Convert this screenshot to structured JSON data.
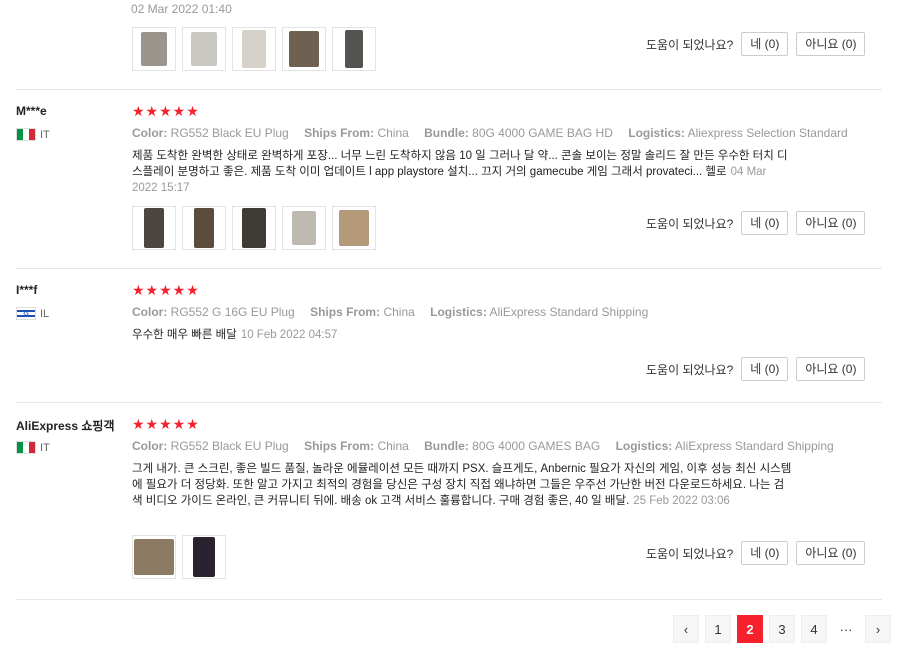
{
  "top_review": {
    "date": "02 Mar 2022 01:40",
    "photo_icons": [
      "photo-1",
      "photo-2",
      "photo-3",
      "photo-4",
      "photo-5"
    ],
    "helpful_q": "도움이 되었나요?",
    "yes_label": "네 (0)",
    "no_label": "아니요 (0)"
  },
  "reviews": [
    {
      "name": "M***e",
      "country": "IT",
      "stars": "★★★★★",
      "attrs": [
        {
          "k": "Color:",
          "v": "RG552 Black EU Plug"
        },
        {
          "k": "Ships From:",
          "v": "China"
        },
        {
          "k": "Bundle:",
          "v": "80G 4000 GAME BAG HD"
        },
        {
          "k": "Logistics:",
          "v": "Aliexpress Selection Standard"
        }
      ],
      "text": "제품 도착한 완벽한 상태로 완벽하게 포장... 너무 느린 도착하지 않음 10 일 그러나 달 약... 콘솔 보이는 정말 솔리드 잘 만든 우수한 터치 디스플레이 분명하고 좋은. 제품 도착 이미 업데이트 l app playstore 설치... 끄지 거의 gamecube 게임 그래서 provateci... 헬로",
      "date": "04 Mar 2022 15:17",
      "helpful_q": "도움이 되었나요?",
      "yes_label": "네 (0)",
      "no_label": "아니요 (0)"
    },
    {
      "name": "I***f",
      "country": "IL",
      "stars": "★★★★★",
      "attrs": [
        {
          "k": "Color:",
          "v": "RG552 G 16G EU Plug"
        },
        {
          "k": "Ships From:",
          "v": "China"
        },
        {
          "k": "Logistics:",
          "v": "AliExpress Standard Shipping"
        }
      ],
      "text": "우수한 매우 빠른 배달",
      "date": "10 Feb 2022 04:57",
      "helpful_q": "도움이 되었나요?",
      "yes_label": "네 (0)",
      "no_label": "아니요 (0)"
    },
    {
      "name": "AliExpress 쇼핑객",
      "country": "IT",
      "stars": "★★★★★",
      "attrs": [
        {
          "k": "Color:",
          "v": "RG552 Black EU Plug"
        },
        {
          "k": "Ships From:",
          "v": "China"
        },
        {
          "k": "Bundle:",
          "v": "80G 4000 GAMES BAG"
        },
        {
          "k": "Logistics:",
          "v": "AliExpress Standard Shipping"
        }
      ],
      "text": "그게 내가. 큰 스크린, 좋은 빌드 품질, 놀라운 에뮬레이션 모든 때까지 PSX. 슬프게도, Anbernic 필요가 자신의 게임, 이후 성능 최신 시스템에 필요가 더 정당화. 또한 알고 가지고 최적의 경험을 당신은 구성 장치 직접 왜냐하면 그들은 우주선 가난한 버전 다운로드하세요. 나는 검색 비디오 가이드 온라인, 큰 커뮤니티 뒤에. 배송 ok 고객 서비스 훌륭합니다. 구매 경험 좋은, 40 일 배달.",
      "date": "25 Feb 2022 03:06",
      "helpful_q": "도움이 되었나요?",
      "yes_label": "네 (0)",
      "no_label": "아니요 (0)"
    }
  ],
  "pagination": {
    "prev": "‹",
    "pages": [
      "1",
      "2",
      "3",
      "4"
    ],
    "current": "2",
    "ellipsis": "···",
    "next": "›"
  },
  "colors": {
    "accent": "#f5222d",
    "muted": "#999999"
  }
}
